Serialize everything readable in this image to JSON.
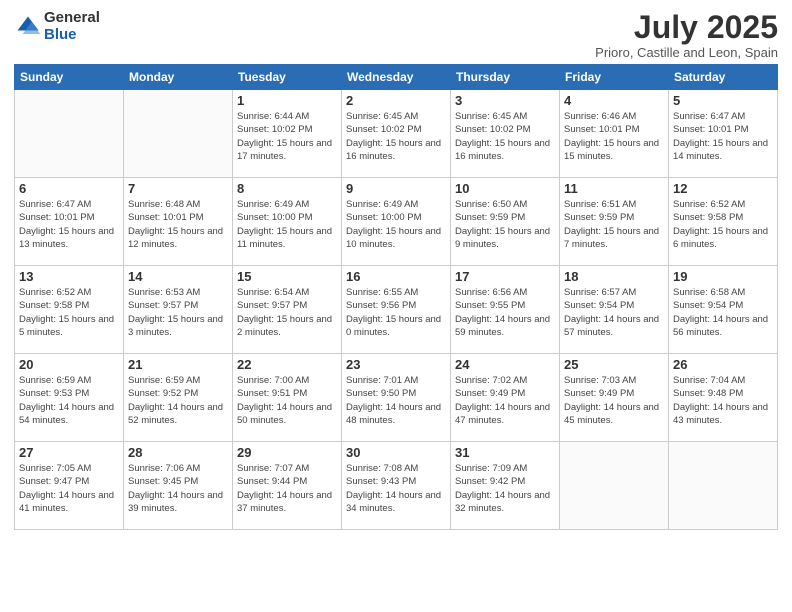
{
  "logo": {
    "general": "General",
    "blue": "Blue"
  },
  "header": {
    "title": "July 2025",
    "subtitle": "Prioro, Castille and Leon, Spain"
  },
  "weekdays": [
    "Sunday",
    "Monday",
    "Tuesday",
    "Wednesday",
    "Thursday",
    "Friday",
    "Saturday"
  ],
  "weeks": [
    [
      {
        "day": "",
        "empty": true
      },
      {
        "day": "",
        "empty": true
      },
      {
        "day": "1",
        "sunrise": "Sunrise: 6:44 AM",
        "sunset": "Sunset: 10:02 PM",
        "daylight": "Daylight: 15 hours and 17 minutes."
      },
      {
        "day": "2",
        "sunrise": "Sunrise: 6:45 AM",
        "sunset": "Sunset: 10:02 PM",
        "daylight": "Daylight: 15 hours and 16 minutes."
      },
      {
        "day": "3",
        "sunrise": "Sunrise: 6:45 AM",
        "sunset": "Sunset: 10:02 PM",
        "daylight": "Daylight: 15 hours and 16 minutes."
      },
      {
        "day": "4",
        "sunrise": "Sunrise: 6:46 AM",
        "sunset": "Sunset: 10:01 PM",
        "daylight": "Daylight: 15 hours and 15 minutes."
      },
      {
        "day": "5",
        "sunrise": "Sunrise: 6:47 AM",
        "sunset": "Sunset: 10:01 PM",
        "daylight": "Daylight: 15 hours and 14 minutes."
      }
    ],
    [
      {
        "day": "6",
        "sunrise": "Sunrise: 6:47 AM",
        "sunset": "Sunset: 10:01 PM",
        "daylight": "Daylight: 15 hours and 13 minutes."
      },
      {
        "day": "7",
        "sunrise": "Sunrise: 6:48 AM",
        "sunset": "Sunset: 10:01 PM",
        "daylight": "Daylight: 15 hours and 12 minutes."
      },
      {
        "day": "8",
        "sunrise": "Sunrise: 6:49 AM",
        "sunset": "Sunset: 10:00 PM",
        "daylight": "Daylight: 15 hours and 11 minutes."
      },
      {
        "day": "9",
        "sunrise": "Sunrise: 6:49 AM",
        "sunset": "Sunset: 10:00 PM",
        "daylight": "Daylight: 15 hours and 10 minutes."
      },
      {
        "day": "10",
        "sunrise": "Sunrise: 6:50 AM",
        "sunset": "Sunset: 9:59 PM",
        "daylight": "Daylight: 15 hours and 9 minutes."
      },
      {
        "day": "11",
        "sunrise": "Sunrise: 6:51 AM",
        "sunset": "Sunset: 9:59 PM",
        "daylight": "Daylight: 15 hours and 7 minutes."
      },
      {
        "day": "12",
        "sunrise": "Sunrise: 6:52 AM",
        "sunset": "Sunset: 9:58 PM",
        "daylight": "Daylight: 15 hours and 6 minutes."
      }
    ],
    [
      {
        "day": "13",
        "sunrise": "Sunrise: 6:52 AM",
        "sunset": "Sunset: 9:58 PM",
        "daylight": "Daylight: 15 hours and 5 minutes."
      },
      {
        "day": "14",
        "sunrise": "Sunrise: 6:53 AM",
        "sunset": "Sunset: 9:57 PM",
        "daylight": "Daylight: 15 hours and 3 minutes."
      },
      {
        "day": "15",
        "sunrise": "Sunrise: 6:54 AM",
        "sunset": "Sunset: 9:57 PM",
        "daylight": "Daylight: 15 hours and 2 minutes."
      },
      {
        "day": "16",
        "sunrise": "Sunrise: 6:55 AM",
        "sunset": "Sunset: 9:56 PM",
        "daylight": "Daylight: 15 hours and 0 minutes."
      },
      {
        "day": "17",
        "sunrise": "Sunrise: 6:56 AM",
        "sunset": "Sunset: 9:55 PM",
        "daylight": "Daylight: 14 hours and 59 minutes."
      },
      {
        "day": "18",
        "sunrise": "Sunrise: 6:57 AM",
        "sunset": "Sunset: 9:54 PM",
        "daylight": "Daylight: 14 hours and 57 minutes."
      },
      {
        "day": "19",
        "sunrise": "Sunrise: 6:58 AM",
        "sunset": "Sunset: 9:54 PM",
        "daylight": "Daylight: 14 hours and 56 minutes."
      }
    ],
    [
      {
        "day": "20",
        "sunrise": "Sunrise: 6:59 AM",
        "sunset": "Sunset: 9:53 PM",
        "daylight": "Daylight: 14 hours and 54 minutes."
      },
      {
        "day": "21",
        "sunrise": "Sunrise: 6:59 AM",
        "sunset": "Sunset: 9:52 PM",
        "daylight": "Daylight: 14 hours and 52 minutes."
      },
      {
        "day": "22",
        "sunrise": "Sunrise: 7:00 AM",
        "sunset": "Sunset: 9:51 PM",
        "daylight": "Daylight: 14 hours and 50 minutes."
      },
      {
        "day": "23",
        "sunrise": "Sunrise: 7:01 AM",
        "sunset": "Sunset: 9:50 PM",
        "daylight": "Daylight: 14 hours and 48 minutes."
      },
      {
        "day": "24",
        "sunrise": "Sunrise: 7:02 AM",
        "sunset": "Sunset: 9:49 PM",
        "daylight": "Daylight: 14 hours and 47 minutes."
      },
      {
        "day": "25",
        "sunrise": "Sunrise: 7:03 AM",
        "sunset": "Sunset: 9:49 PM",
        "daylight": "Daylight: 14 hours and 45 minutes."
      },
      {
        "day": "26",
        "sunrise": "Sunrise: 7:04 AM",
        "sunset": "Sunset: 9:48 PM",
        "daylight": "Daylight: 14 hours and 43 minutes."
      }
    ],
    [
      {
        "day": "27",
        "sunrise": "Sunrise: 7:05 AM",
        "sunset": "Sunset: 9:47 PM",
        "daylight": "Daylight: 14 hours and 41 minutes."
      },
      {
        "day": "28",
        "sunrise": "Sunrise: 7:06 AM",
        "sunset": "Sunset: 9:45 PM",
        "daylight": "Daylight: 14 hours and 39 minutes."
      },
      {
        "day": "29",
        "sunrise": "Sunrise: 7:07 AM",
        "sunset": "Sunset: 9:44 PM",
        "daylight": "Daylight: 14 hours and 37 minutes."
      },
      {
        "day": "30",
        "sunrise": "Sunrise: 7:08 AM",
        "sunset": "Sunset: 9:43 PM",
        "daylight": "Daylight: 14 hours and 34 minutes."
      },
      {
        "day": "31",
        "sunrise": "Sunrise: 7:09 AM",
        "sunset": "Sunset: 9:42 PM",
        "daylight": "Daylight: 14 hours and 32 minutes."
      },
      {
        "day": "",
        "empty": true
      },
      {
        "day": "",
        "empty": true
      }
    ]
  ]
}
